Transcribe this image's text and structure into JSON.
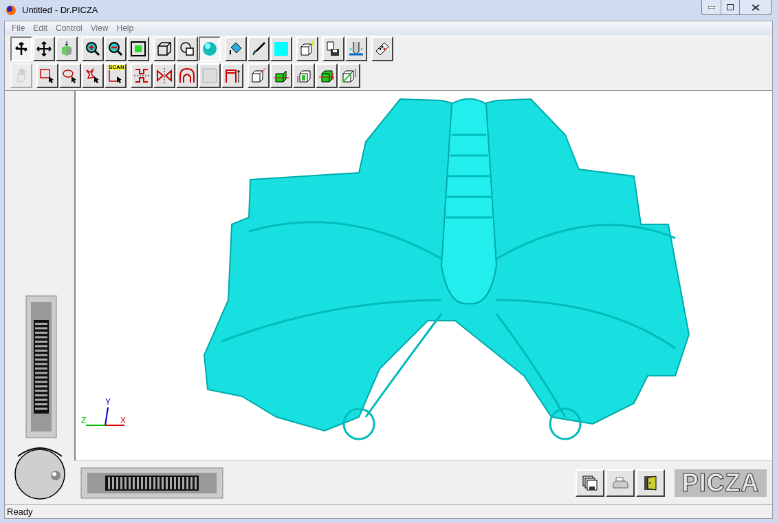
{
  "window": {
    "title": "Untitled - Dr.PICZA"
  },
  "menu": [
    "File",
    "Edit",
    "Control",
    "View",
    "Help"
  ],
  "toolbar_1": [
    [
      {
        "kind": "rotate",
        "selected": true,
        "disabled": false
      },
      {
        "kind": "move",
        "selected": false,
        "disabled": false
      },
      {
        "kind": "import",
        "selected": false,
        "disabled": false
      }
    ],
    [
      {
        "kind": "zoom-in",
        "selected": false,
        "disabled": false
      },
      {
        "kind": "zoom-out",
        "selected": false,
        "disabled": false
      },
      {
        "kind": "fit",
        "selected": false,
        "disabled": false
      }
    ],
    [
      {
        "kind": "wireframe",
        "selected": false,
        "disabled": false
      },
      {
        "kind": "outline",
        "selected": false,
        "disabled": false
      },
      {
        "kind": "shaded",
        "selected": true,
        "disabled": false
      }
    ],
    [
      {
        "kind": "fill",
        "selected": false,
        "disabled": false
      },
      {
        "kind": "brush",
        "selected": false,
        "disabled": false
      },
      {
        "kind": "swatch",
        "selected": false,
        "disabled": false
      }
    ],
    [
      {
        "kind": "cube-help",
        "selected": false,
        "disabled": false
      }
    ],
    [
      {
        "kind": "save-as",
        "selected": false,
        "disabled": false
      },
      {
        "kind": "scan",
        "selected": false,
        "disabled": false
      }
    ],
    [
      {
        "kind": "remote",
        "selected": false,
        "disabled": false
      }
    ]
  ],
  "toolbar_2": [
    [
      {
        "kind": "hand",
        "selected": false,
        "disabled": true
      }
    ],
    [
      {
        "kind": "rect-select",
        "selected": false,
        "disabled": false
      },
      {
        "kind": "ellipse-select",
        "selected": false,
        "disabled": false
      },
      {
        "kind": "polygon-select",
        "selected": false,
        "disabled": false
      },
      {
        "kind": "scan-select",
        "label": "SCAN",
        "selected": false,
        "disabled": false
      }
    ],
    [
      {
        "kind": "cut",
        "selected": false,
        "disabled": false
      },
      {
        "kind": "mirror",
        "selected": false,
        "disabled": false
      },
      {
        "kind": "arch",
        "selected": false,
        "disabled": false
      },
      {
        "kind": "grid",
        "selected": false,
        "disabled": false
      },
      {
        "kind": "frame",
        "selected": false,
        "disabled": false
      }
    ],
    [
      {
        "kind": "cube-move",
        "selected": false,
        "disabled": false
      },
      {
        "kind": "cube-x",
        "selected": false,
        "disabled": false
      },
      {
        "kind": "cube-y",
        "selected": false,
        "disabled": false
      },
      {
        "kind": "cube-z",
        "selected": false,
        "disabled": false
      },
      {
        "kind": "cube-scale",
        "selected": false,
        "disabled": false
      }
    ]
  ],
  "viewport": {
    "axes": {
      "x": "X",
      "y": "Y",
      "z": "Z"
    }
  },
  "bottom_buttons": [
    {
      "kind": "save-multi"
    },
    {
      "kind": "print"
    },
    {
      "kind": "exit"
    }
  ],
  "logo": "PICZA",
  "status_bar": "Ready"
}
